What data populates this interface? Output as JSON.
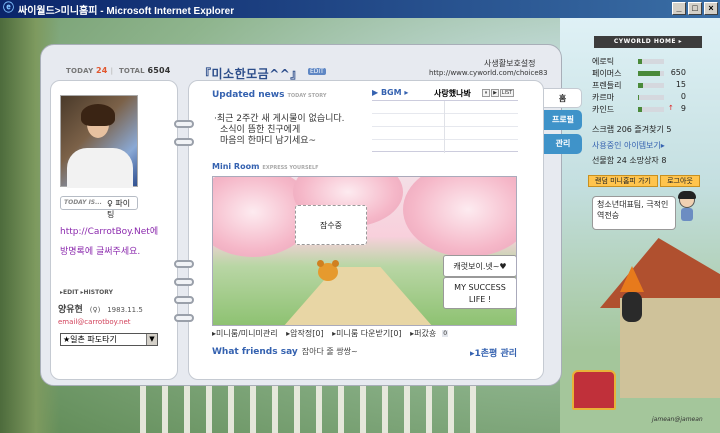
{
  "window": {
    "title": "싸이월드>미니홈피 - Microsoft Internet Explorer"
  },
  "counter": {
    "today_label": "TODAY",
    "today": "24",
    "total_label": "TOTAL",
    "total": "6504"
  },
  "profile": {
    "mood_label": "TODAY IS...",
    "mood_value": "♀ 파이팅",
    "intro_line1": "http://CarrotBoy.Net에",
    "intro_line2": "방명록에 글써주세요.",
    "edit_label": "▸EDIT  ▸HISTORY",
    "name": "양유현",
    "birth": "1983.11.5",
    "gender_mark": "(♀)",
    "email": "email@carrotboy.net",
    "select_value": "★일촌 파도타기"
  },
  "header": {
    "title": "『미소한모금^^』",
    "edit_badge": "EDIT",
    "protect": "사생활보호설정",
    "url": "http://www.cyworld.com/choice83"
  },
  "updated": {
    "title": "Updated news",
    "subtitle": "TODAY STORY",
    "line1": "·최근 2주간 새 게시물이 없습니다.",
    "line2": "소식이 뜸한 친구에게",
    "line3": "마음의 한마디 남기세요~"
  },
  "bgm": {
    "label": "▶ BGM ▸",
    "song": "사랑했나봐",
    "ctrl": [
      "⏸",
      "▶",
      "LIST"
    ]
  },
  "miniroom": {
    "title": "Mini Room",
    "subtitle": "EXPRESS YOURSELF",
    "bubble1": "잠수중",
    "bubble2": "캐럿보이.넷~♥",
    "bubble3_line1": "MY SUCCESS",
    "bubble3_line2": "LIFE !"
  },
  "links": {
    "miniroom": "▸미니룸/미니미관리",
    "photo": "▸압작정[0]",
    "minimi": "▸미니룸 다운받기[0]",
    "scrap": "▸퍼갔숑",
    "scrap_badge": "0"
  },
  "friends": {
    "title": "What friends say",
    "text": "잡아다 줄 쌍쌍~",
    "manage": "▸1촌평 관리"
  },
  "tabs": {
    "home": "홈",
    "profile": "프로필",
    "manage": "관리"
  },
  "side": {
    "cw_home": "CYWORLD HOME ▸",
    "stats": [
      {
        "label": "에로틱",
        "arrow": "",
        "value": "",
        "fill": 0.15
      },
      {
        "label": "페이머스",
        "arrow": "",
        "value": "650",
        "fill": 0.85
      },
      {
        "label": "프렌들리",
        "arrow": "",
        "value": "15",
        "fill": 0.2
      },
      {
        "label": "카르마",
        "arrow": "",
        "value": "0",
        "fill": 0.05
      },
      {
        "label": "카인드",
        "arrow": "↑",
        "value": "9",
        "fill": 0.15
      }
    ],
    "scrap_line": "스크랩 206 즐겨찾기 5",
    "items_line": "사용중인 아이템보기▸",
    "gift_line": "선물함 24 소망상자 8",
    "random_btn": "랜덤 미니홈피 가기",
    "logout_btn": "로그아웃",
    "speech": "청소년대표팀, 극적인 역전승"
  },
  "watermark": "jamean@jamean",
  "colors": {
    "accent_blue": "#3562b0",
    "tab_blue": "#3f93c9",
    "link_purple": "#8c2bae",
    "counter_orange": "#e2572e"
  }
}
